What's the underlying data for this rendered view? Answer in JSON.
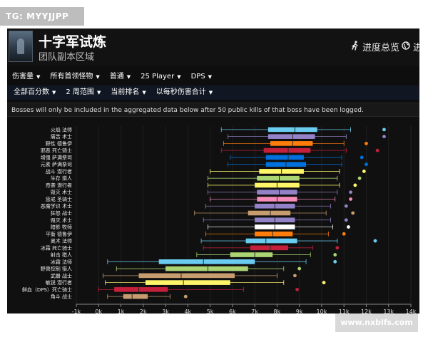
{
  "tag": "TG: MYYJJPP",
  "watermark": "www.nxblfs.com",
  "header": {
    "title": "十字军试炼",
    "subtitle": "团队副本区域",
    "link1": "进度总览",
    "link2": "进"
  },
  "filters_row1": [
    "伤害量",
    "所有首领怪物",
    "普通",
    "25 Player",
    "DPS"
  ],
  "filters_row2": [
    "全部百分数",
    "2 周范围",
    "当前排名",
    "以每秒伤害合计"
  ],
  "notice": "Bosses will only be included in the aggregated data below after 50 public kills of that boss have been logged.",
  "colors": {
    "background": "#0e0e0e",
    "filter_bar2": "#101622",
    "header_text": "#ffffff"
  },
  "chart_data": {
    "type": "boxplot",
    "orientation": "horizontal",
    "x_ticks": [
      "-1k",
      "0k",
      "1k",
      "2k",
      "3k",
      "4k",
      "5k",
      "6k",
      "7k",
      "8k",
      "9k",
      "10k",
      "11k",
      "12k",
      "13k",
      "14k"
    ],
    "xlim": [
      -1000,
      14000
    ],
    "series": [
      {
        "name": "火焰 法师",
        "color": "#69ccf0",
        "min": 5500,
        "q1": 7600,
        "median": 8800,
        "q3": 9800,
        "max": 11300,
        "outlier": 12800
      },
      {
        "name": "痛苦 术士",
        "color": "#9482c9",
        "min": 5800,
        "q1": 7600,
        "median": 8700,
        "q3": 9700,
        "max": 11100,
        "outlier": 12800
      },
      {
        "name": "野性 德鲁伊",
        "color": "#ff7d0a",
        "min": 5600,
        "q1": 7700,
        "median": 8700,
        "q3": 9600,
        "max": 11000,
        "outlier": 12000
      },
      {
        "name": "邪恶 死亡骑士",
        "color": "#c41f3b",
        "min": 5500,
        "q1": 7400,
        "median": 8500,
        "q3": 9500,
        "max": 11100,
        "outlier": 12500
      },
      {
        "name": "增强 萨满祭司",
        "color": "#0070de",
        "min": 5900,
        "q1": 7500,
        "median": 8500,
        "q3": 9200,
        "max": 10900,
        "outlier": 11800
      },
      {
        "name": "元素 萨满祭司",
        "color": "#0070de",
        "min": 5800,
        "q1": 7500,
        "median": 8400,
        "q3": 9300,
        "max": 10900,
        "outlier": 12000
      },
      {
        "name": "战斗 潜行者",
        "color": "#fff569",
        "min": 5000,
        "q1": 7200,
        "median": 8200,
        "q3": 9200,
        "max": 10800,
        "outlier": 11900
      },
      {
        "name": "生存 猎人",
        "color": "#abd473",
        "min": 4900,
        "q1": 7100,
        "median": 8100,
        "q3": 9000,
        "max": 10700,
        "outlier": 11700
      },
      {
        "name": "奇袭 潜行者",
        "color": "#fff569",
        "min": 4900,
        "q1": 7000,
        "median": 8000,
        "q3": 9000,
        "max": 10800,
        "outlier": 11500
      },
      {
        "name": "毁灭 术士",
        "color": "#9482c9",
        "min": 4900,
        "q1": 7100,
        "median": 8100,
        "q3": 8900,
        "max": 10700,
        "outlier": 11300
      },
      {
        "name": "惩戒 圣骑士",
        "color": "#f58cba",
        "min": 5000,
        "q1": 7100,
        "median": 8000,
        "q3": 8900,
        "max": 10600,
        "outlier": 11300
      },
      {
        "name": "恶魔学识 术士",
        "color": "#9482c9",
        "min": 4800,
        "q1": 7000,
        "median": 7900,
        "q3": 8800,
        "max": 10400,
        "outlier": 11100
      },
      {
        "name": "狂怒 战士",
        "color": "#c79c6e",
        "min": 4300,
        "q1": 6700,
        "median": 7700,
        "q3": 8600,
        "max": 10200,
        "outlier": 11400
      },
      {
        "name": "毁灭 术士",
        "color": "#9482c9",
        "min": 4700,
        "q1": 7000,
        "median": 7900,
        "q3": 8800,
        "max": 10400,
        "outlier": 11100
      },
      {
        "name": "暗影 牧师",
        "color": "#ffffff",
        "min": 4900,
        "q1": 7000,
        "median": 7900,
        "q3": 8800,
        "max": 10500,
        "outlier": 11200
      },
      {
        "name": "平衡 德鲁伊",
        "color": "#ff7d0a",
        "min": 4800,
        "q1": 7000,
        "median": 7800,
        "q3": 8700,
        "max": 10300,
        "outlier": 11000
      },
      {
        "name": "奥术 法师",
        "color": "#69ccf0",
        "min": 4600,
        "q1": 6600,
        "median": 7500,
        "q3": 8900,
        "max": 10700,
        "outlier": 12400
      },
      {
        "name": "冰霜 死亡骑士",
        "color": "#c41f3b",
        "min": 4700,
        "q1": 6800,
        "median": 7700,
        "q3": 8500,
        "max": 9600,
        "outlier": 10700
      },
      {
        "name": "射击 猎人",
        "color": "#abd473",
        "min": 4400,
        "q1": 5900,
        "median": 7000,
        "q3": 7800,
        "max": 9500,
        "outlier": 10600
      },
      {
        "name": "冰霜 法师",
        "color": "#69ccf0",
        "min": 400,
        "q1": 2700,
        "median": 4700,
        "q3": 7000,
        "max": 9300,
        "outlier": 10600
      },
      {
        "name": "野兽控制 猎人",
        "color": "#abd473",
        "min": 800,
        "q1": 3000,
        "median": 4900,
        "q3": 6700,
        "max": 8300,
        "outlier": 9000
      },
      {
        "name": "武器 战士",
        "color": "#c79c6e",
        "min": 200,
        "q1": 1800,
        "median": 3700,
        "q3": 6100,
        "max": 8000,
        "outlier": 8800
      },
      {
        "name": "敏锐 潜行者",
        "color": "#fff569",
        "min": 300,
        "q1": 2100,
        "median": 3800,
        "q3": 5900,
        "max": 8300,
        "outlier": 10100
      },
      {
        "name": "鲜血（DPS）死亡骑士",
        "color": "#c41f3b",
        "min": 0,
        "q1": 700,
        "median": 1800,
        "q3": 3100,
        "max": 6500,
        "outlier": 8900
      },
      {
        "name": "角斗 战士",
        "color": "#c79c6e",
        "min": 400,
        "q1": 1100,
        "median": 1500,
        "q3": 2200,
        "max": 3200,
        "outlier": 3900
      }
    ]
  }
}
